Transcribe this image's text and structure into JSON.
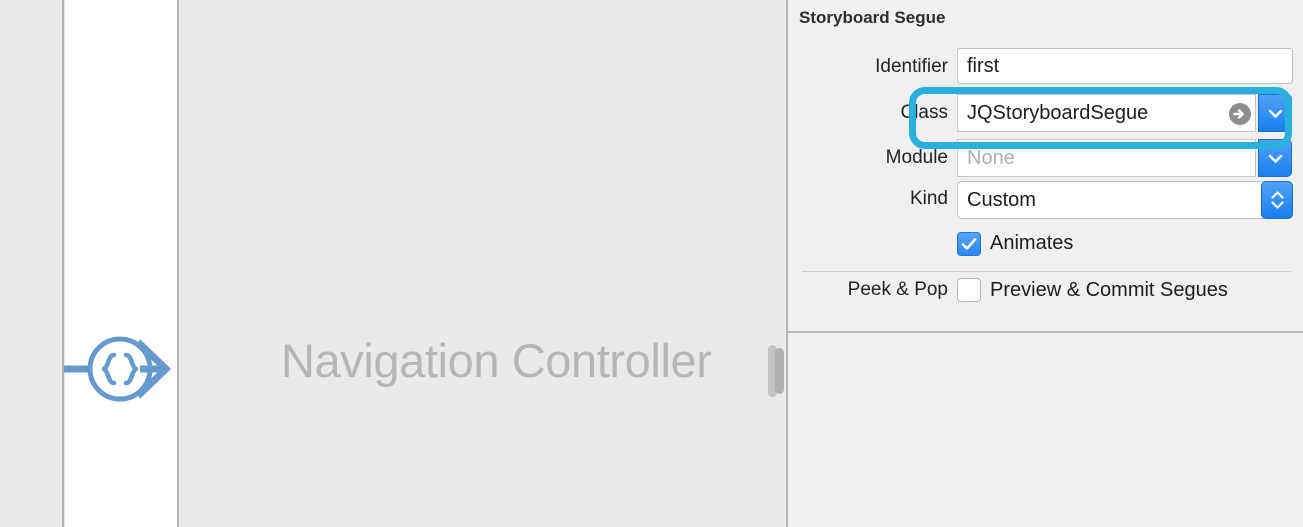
{
  "canvas": {
    "scene_title": "Navigation Controller",
    "segue_icon": "segue-braces-arrow-icon"
  },
  "inspector": {
    "section_title": "Storyboard Segue",
    "rows": [
      {
        "label": "Identifier",
        "value": "first",
        "placeholder": "",
        "control": "text-field"
      },
      {
        "label": "Class",
        "value": "JQStoryboardSegue",
        "placeholder": "",
        "control": "combo-box",
        "badge_icon": "arrow-right-circle-icon",
        "dropdown_icon": "chevron-down-icon",
        "focused": true
      },
      {
        "label": "Module",
        "value": "",
        "placeholder": "None",
        "control": "combo-box",
        "dropdown_icon": "chevron-down-icon"
      },
      {
        "label": "Kind",
        "value": "Custom",
        "placeholder": "",
        "control": "popup-button",
        "dropdown_icon": "chevron-up-down-icon"
      }
    ],
    "checkboxes": [
      {
        "label": "Animates",
        "checked": true,
        "row_label": "",
        "icon": "checkmark-icon"
      },
      {
        "label": "Preview & Commit Segues",
        "checked": false,
        "row_label": "Peek & Pop",
        "icon": ""
      }
    ]
  },
  "colors": {
    "accent_blue": "#2b86f4",
    "highlight_ring": "#29b0de",
    "panel_bg": "#f0f0f0",
    "canvas_bg": "#eaeaea",
    "segue_glyph": "#6699cc",
    "scene_title": "#b6b6b6"
  }
}
